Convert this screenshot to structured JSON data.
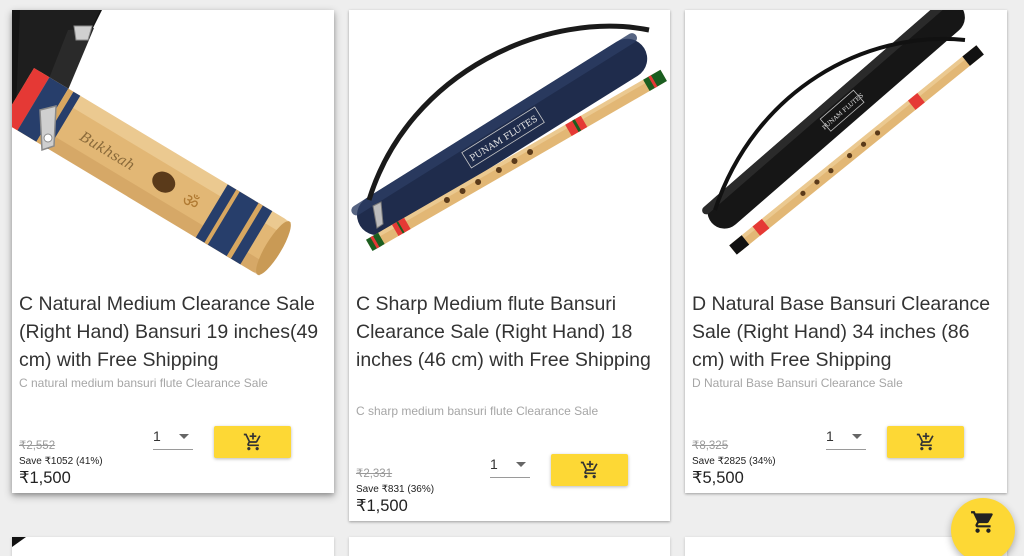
{
  "products": [
    {
      "title": "C Natural Medium Clearance Sale (Right Hand) Bansuri 19 inches(49 cm) with Free Shipping",
      "subtitle": "C natural medium bansuri flute Clearance Sale",
      "old_price": "₹2,552",
      "save_text": "Save ₹1052 (41%)",
      "price": "₹1,500",
      "qty": "1",
      "image_icon": "bansuri-flute-closeup-image",
      "flute_engraving": "Bukhsah"
    },
    {
      "title": "C Sharp Medium flute Bansuri Clearance Sale (Right Hand) 18 inches (46 cm) with Free Shipping",
      "subtitle": "C sharp medium bansuri flute Clearance Sale",
      "old_price": "₹2,331",
      "save_text": "Save ₹831 (36%)",
      "price": "₹1,500",
      "qty": "1",
      "image_icon": "bansuri-flute-with-navy-case-image",
      "bag_print": "PUNAM FLUTES"
    },
    {
      "title": "D Natural Base Bansuri Clearance Sale (Right Hand) 34 inches (86 cm) with Free Shipping",
      "subtitle": "D Natural Base Bansuri Clearance Sale",
      "old_price": "₹8,325",
      "save_text": "Save ₹2825 (34%)",
      "price": "₹5,500",
      "qty": "1",
      "image_icon": "bansuri-flute-with-black-case-image",
      "bag_print": "PUNAM FLUTES"
    }
  ],
  "icons": {
    "add_to_cart": "add-shopping-cart-icon",
    "fab_cart": "shopping-cart-icon",
    "qty_dropdown": "chevron-down-icon"
  },
  "colors": {
    "accent": "#fdd835",
    "background": "#eeeeee",
    "card": "#ffffff",
    "bamboo": "#e2b775"
  }
}
